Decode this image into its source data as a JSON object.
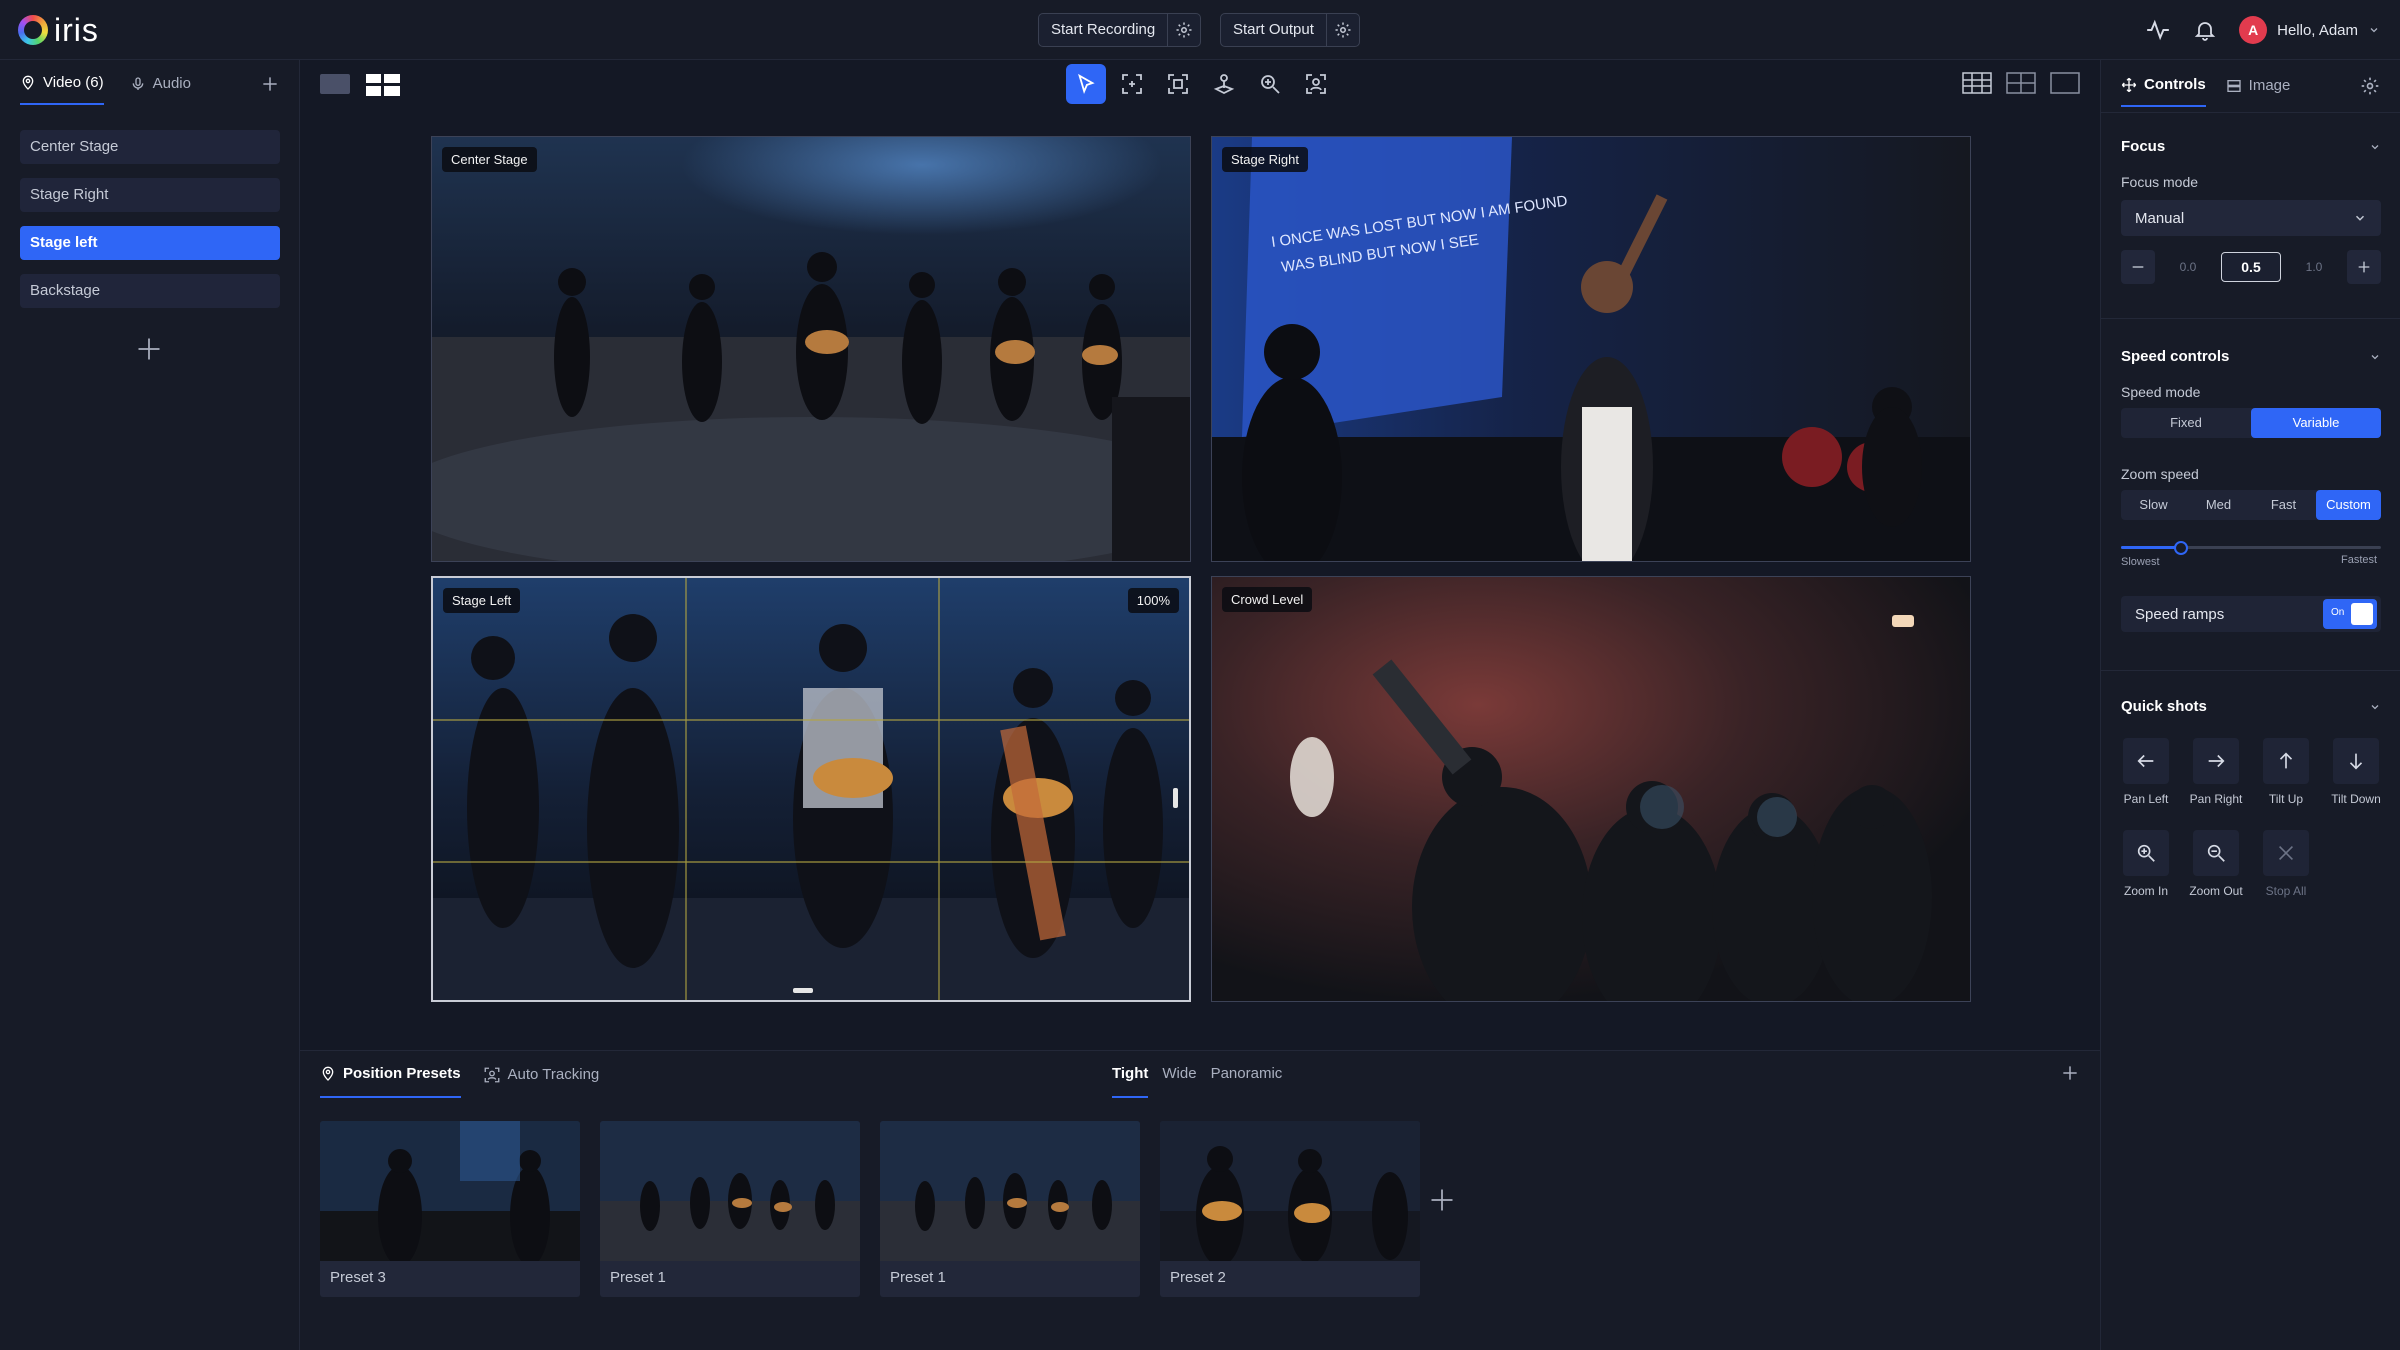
{
  "app": {
    "logo_text": "iris"
  },
  "topbar": {
    "start_recording": "Start Recording",
    "start_output": "Start Output",
    "greeting": "Hello, Adam",
    "avatar_initial": "A"
  },
  "left": {
    "tabs": [
      {
        "label": "Video (6)"
      },
      {
        "label": "Audio"
      }
    ],
    "sources": [
      {
        "label": "Center Stage"
      },
      {
        "label": "Stage Right"
      },
      {
        "label": "Stage left"
      },
      {
        "label": "Backstage"
      }
    ]
  },
  "feeds": [
    {
      "label": "Center Stage"
    },
    {
      "label": "Stage Right"
    },
    {
      "label": "Stage Left",
      "zoom": "100%"
    },
    {
      "label": "Crowd Level"
    }
  ],
  "presets": {
    "tabs": [
      {
        "label": "Position Presets"
      },
      {
        "label": "Auto Tracking"
      }
    ],
    "framing": [
      "Tight",
      "Wide",
      "Panoramic"
    ],
    "cards": [
      {
        "label": "Preset 3"
      },
      {
        "label": "Preset 1"
      },
      {
        "label": "Preset 1"
      },
      {
        "label": "Preset 2"
      }
    ]
  },
  "right": {
    "tabs": [
      {
        "label": "Controls"
      },
      {
        "label": "Image"
      }
    ],
    "focus": {
      "title": "Focus",
      "mode_label": "Focus mode",
      "mode_value": "Manual",
      "min": "0.0",
      "value": "0.5",
      "max": "1.0"
    },
    "speed": {
      "title": "Speed controls",
      "mode_label": "Speed mode",
      "modes": [
        "Fixed",
        "Variable"
      ],
      "zoom_label": "Zoom speed",
      "zoom_options": [
        "Slow",
        "Med",
        "Fast",
        "Custom"
      ],
      "slider_value": 0.23,
      "slider_min_label": "Slowest",
      "slider_max_label": "Fastest",
      "ramps_label": "Speed ramps",
      "ramps_state": "On"
    },
    "quick": {
      "title": "Quick shots",
      "items": [
        "Pan Left",
        "Pan Right",
        "Tilt Up",
        "Tilt Down",
        "Zoom In",
        "Zoom Out",
        "Stop All"
      ]
    }
  },
  "colors": {
    "accent": "#2f66f6",
    "background": "#12151f",
    "panel": "#171b27"
  }
}
